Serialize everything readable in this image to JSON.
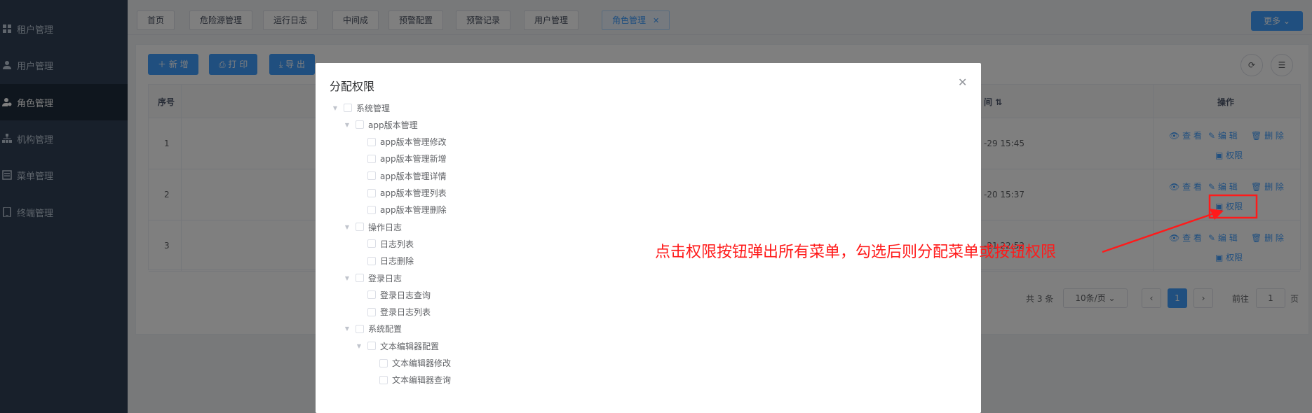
{
  "sidebar": {
    "items": [
      {
        "label": "租户管理",
        "icon": "grid-icon"
      },
      {
        "label": "用户管理",
        "icon": "user-icon"
      },
      {
        "label": "角色管理",
        "icon": "role-icon",
        "active": true
      },
      {
        "label": "机构管理",
        "icon": "org-icon"
      },
      {
        "label": "菜单管理",
        "icon": "menu-icon"
      },
      {
        "label": "终端管理",
        "icon": "terminal-icon"
      }
    ]
  },
  "tags": [
    "首页",
    "危险源管理",
    "运行日志",
    "中间成",
    "预警配置",
    "预警记录",
    "用户管理",
    "角色管理"
  ],
  "more_label": "更多",
  "toolbar": {
    "add": "新 增",
    "print": "打 印",
    "export": "导 出"
  },
  "table": {
    "col_seq": "序号",
    "col_time": "间",
    "col_op": "操作",
    "rows": [
      {
        "seq": "1",
        "time": "-29 15:45"
      },
      {
        "seq": "2",
        "time": "-20 15:37"
      },
      {
        "seq": "3",
        "time": "-21 22:52"
      }
    ],
    "op_view": "查 看",
    "op_edit": "编 辑",
    "op_delete": "删 除",
    "op_perm": "权限"
  },
  "pagination": {
    "total": "共 3 条",
    "size": "10条/页",
    "page": "1",
    "goto_label": "前往",
    "goto_value": "1",
    "goto_suffix": "页"
  },
  "dialog": {
    "title": "分配权限",
    "tree": [
      {
        "label": "系统管理",
        "level": 0,
        "expandable": true
      },
      {
        "label": "app版本管理",
        "level": 1,
        "expandable": true
      },
      {
        "label": "app版本管理修改",
        "level": 2,
        "expandable": false
      },
      {
        "label": "app版本管理新增",
        "level": 2,
        "expandable": false
      },
      {
        "label": "app版本管理详情",
        "level": 2,
        "expandable": false
      },
      {
        "label": "app版本管理列表",
        "level": 2,
        "expandable": false
      },
      {
        "label": "app版本管理删除",
        "level": 2,
        "expandable": false
      },
      {
        "label": "操作日志",
        "level": 1,
        "expandable": true
      },
      {
        "label": "日志列表",
        "level": 2,
        "expandable": false
      },
      {
        "label": "日志删除",
        "level": 2,
        "expandable": false
      },
      {
        "label": "登录日志",
        "level": 1,
        "expandable": true
      },
      {
        "label": "登录日志查询",
        "level": 2,
        "expandable": false
      },
      {
        "label": "登录日志列表",
        "level": 2,
        "expandable": false
      },
      {
        "label": "系统配置",
        "level": 1,
        "expandable": true
      },
      {
        "label": "文本编辑器配置",
        "level": 2,
        "expandable": true
      },
      {
        "label": "文本编辑器修改",
        "level": 3,
        "expandable": false
      },
      {
        "label": "文本编辑器查询",
        "level": 3,
        "expandable": false
      }
    ]
  },
  "annotation": {
    "text": "点击权限按钮弹出所有菜单，勾选后则分配菜单或按钮权限",
    "color": "#ff1a1a"
  },
  "colors": {
    "primary": "#409eff",
    "sidebar": "#304156",
    "sidebar_active": "#1f2d3d"
  }
}
